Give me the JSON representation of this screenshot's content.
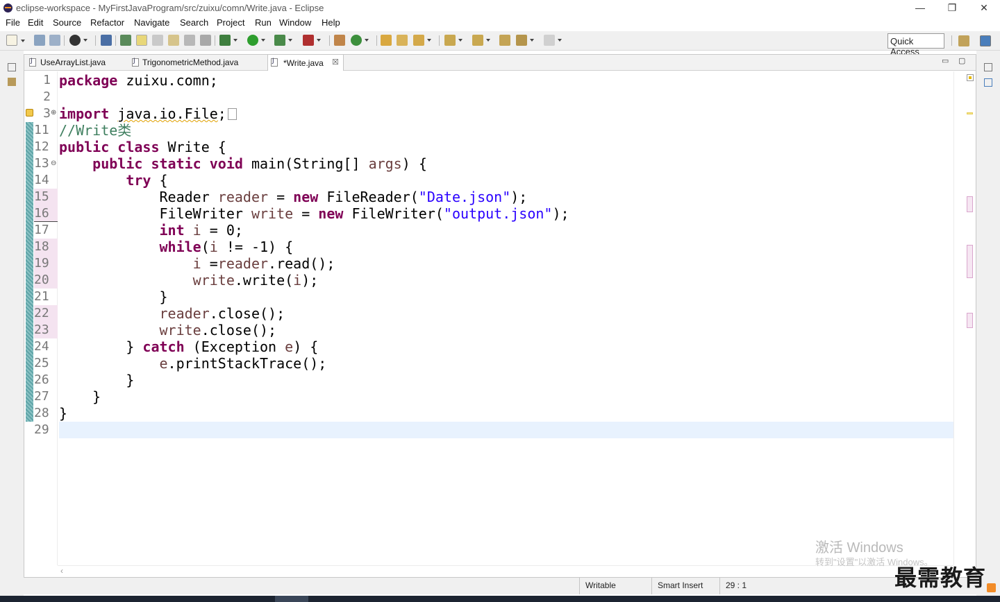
{
  "window": {
    "title": "eclipse-workspace - MyFirstJavaProgram/src/zuixu/comn/Write.java - Eclipse",
    "minimize": "—",
    "restore": "❐",
    "close": "✕"
  },
  "menu": [
    "File",
    "Edit",
    "Source",
    "Refactor",
    "Navigate",
    "Search",
    "Project",
    "Run",
    "Window",
    "Help"
  ],
  "toolbar": {
    "quick_access": "Quick Access"
  },
  "tabs": [
    {
      "label": "UseArrayList.java",
      "active": false
    },
    {
      "label": "TrigonometricMethod.java",
      "active": false
    },
    {
      "label": "*Write.java",
      "active": true,
      "close": "☒"
    }
  ],
  "tab_controls": {
    "minimize": "▭",
    "maximize": "▢"
  },
  "editor": {
    "line_numbers": [
      "1",
      "2",
      "3",
      "11",
      "12",
      "13",
      "14",
      "15",
      "16",
      "17",
      "18",
      "19",
      "20",
      "21",
      "22",
      "23",
      "24",
      "25",
      "26",
      "27",
      "28",
      "29"
    ],
    "fold_expand": "⊕",
    "fold_collapse": "⊖",
    "tokens": {
      "l1": [
        "package",
        " zuixu.comn;"
      ],
      "l3": [
        "import",
        " ",
        "java.io.File",
        ";"
      ],
      "l11": "//Write类",
      "l12": [
        "public",
        " ",
        "class",
        " Write {"
      ],
      "l13": [
        "    ",
        "public",
        " ",
        "static",
        " ",
        "void",
        " main(String[] ",
        "args",
        ") {"
      ],
      "l14": [
        "        ",
        "try",
        " {"
      ],
      "l15": [
        "            Reader ",
        "reader",
        " = ",
        "new",
        " FileReader(",
        "\"Date.json\"",
        ");"
      ],
      "l16": [
        "            FileWriter ",
        "write",
        " = ",
        "new",
        " FileWriter(",
        "\"output.json\"",
        ");"
      ],
      "l17": [
        "            ",
        "int",
        " ",
        "i",
        " = 0;"
      ],
      "l18": [
        "            ",
        "while",
        "(",
        "i",
        " != -1) {"
      ],
      "l19": [
        "                ",
        "i",
        " =",
        "reader",
        ".read();"
      ],
      "l20": [
        "                ",
        "write",
        ".write(",
        "i",
        ");"
      ],
      "l21": "            }",
      "l22": [
        "            ",
        "reader",
        ".close();"
      ],
      "l23": [
        "            ",
        "write",
        ".close();"
      ],
      "l24": [
        "        } ",
        "catch",
        " (Exception ",
        "e",
        ") {"
      ],
      "l25": [
        "            ",
        "e",
        ".printStackTrace();"
      ],
      "l26": "        }",
      "l27": "    }",
      "l28": "}"
    }
  },
  "status": {
    "writable": "Writable",
    "insert_mode": "Smart Insert",
    "position": "29 : 1"
  },
  "watermark": {
    "line1": "激活 Windows",
    "line2": "转到\"设置\"以激活 Windows。"
  },
  "brand": "最需教育",
  "colors": {
    "keyword": "#7f0055",
    "string": "#2a00ff",
    "variable": "#6a3e3e",
    "comment": "#3f7f5f",
    "current_line": "#e8f2fe"
  }
}
